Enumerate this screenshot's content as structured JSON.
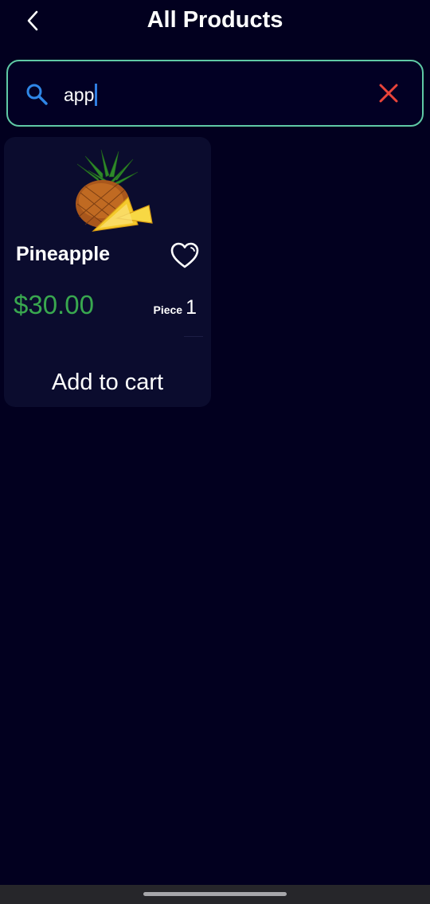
{
  "header": {
    "title": "All Products",
    "back_icon": "chevron-left-icon"
  },
  "search": {
    "value": "app",
    "search_icon": "search-icon",
    "clear_icon": "close-icon",
    "border_color": "#5fc9a5",
    "clear_color": "#e8443a"
  },
  "products": [
    {
      "name": "Pineapple",
      "image": "pineapple-image",
      "price": "$30.00",
      "unit": "Piece",
      "quantity": "1",
      "favorite_icon": "heart-outline-icon",
      "cta": "Add to cart",
      "price_color": "#39a84f"
    }
  ],
  "theme": {
    "background": "#02001f",
    "card_background": "#0b0c2e"
  }
}
